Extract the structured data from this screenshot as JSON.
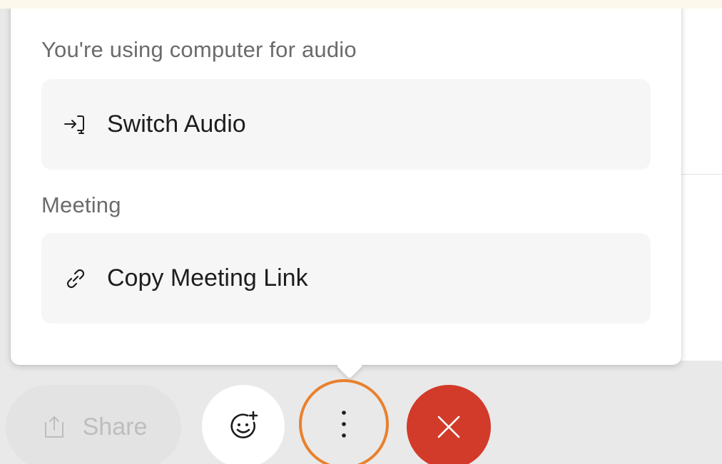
{
  "popover": {
    "audio_section_label": "You're using computer for audio",
    "switch_audio_label": "Switch Audio",
    "meeting_section_label": "Meeting",
    "copy_link_label": "Copy Meeting Link"
  },
  "toolbar": {
    "share_label": "Share",
    "share_icon": "share-upload-icon",
    "reaction_icon": "add-reaction-icon",
    "more_icon": "more-vertical-icon",
    "end_icon": "close-icon"
  },
  "colors": {
    "accent_ring": "#e8812e",
    "end_button": "#d23a2a",
    "menu_item_bg": "#f6f6f6"
  }
}
